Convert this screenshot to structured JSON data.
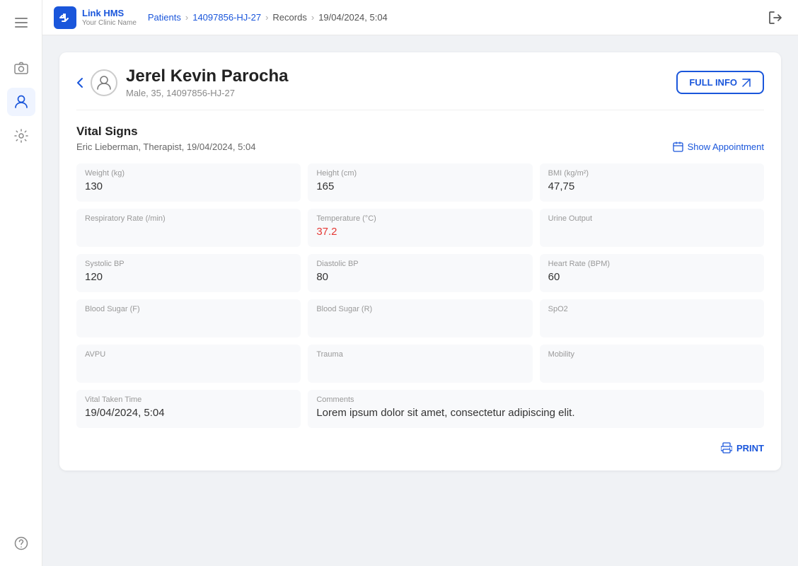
{
  "app": {
    "title": "Link HMS",
    "subtitle": "Your Clinic Name"
  },
  "topnav": {
    "menu_icon": "☰",
    "breadcrumb": {
      "patients": "Patients",
      "patient_id": "14097856-HJ-27",
      "records": "Records",
      "timestamp": "19/04/2024, 5:04"
    },
    "logout_icon": "⇥"
  },
  "sidebar": {
    "items": [
      {
        "name": "calendar-icon",
        "icon": "📷",
        "active": false
      },
      {
        "name": "patients-icon",
        "icon": "👤",
        "active": true
      },
      {
        "name": "settings-icon",
        "icon": "⚙",
        "active": false
      },
      {
        "name": "help-icon",
        "icon": "?",
        "active": false
      }
    ]
  },
  "patient": {
    "name": "Jerel Kevin Parocha",
    "meta": "Male, 35, 14097856-HJ-27",
    "full_info_label": "FULL INFO"
  },
  "vital_signs": {
    "section_title": "Vital Signs",
    "provider": "Eric Lieberman, Therapist, 19/04/2024, 5:04",
    "show_appointment_label": "Show Appointment",
    "fields": [
      {
        "label": "Weight (kg)",
        "value": "130",
        "highlight": false,
        "span": 1
      },
      {
        "label": "Height (cm)",
        "value": "165",
        "highlight": false,
        "span": 1
      },
      {
        "label": "BMI (kg/m²)",
        "value": "47,75",
        "highlight": false,
        "span": 1
      },
      {
        "label": "Respiratory Rate (/min)",
        "value": "",
        "highlight": false,
        "span": 1
      },
      {
        "label": "Temperature (°C)",
        "value": "37.2",
        "highlight": true,
        "span": 1
      },
      {
        "label": "Urine Output",
        "value": "",
        "highlight": false,
        "span": 1
      },
      {
        "label": "Systolic BP",
        "value": "120",
        "highlight": false,
        "span": 1
      },
      {
        "label": "Diastolic BP",
        "value": "80",
        "highlight": false,
        "span": 1
      },
      {
        "label": "Heart Rate (BPM)",
        "value": "60",
        "highlight": false,
        "span": 1
      },
      {
        "label": "Blood Sugar (F)",
        "value": "",
        "highlight": false,
        "span": 1
      },
      {
        "label": "Blood Sugar (R)",
        "value": "",
        "highlight": false,
        "span": 1
      },
      {
        "label": "SpO2",
        "value": "",
        "highlight": false,
        "span": 1
      },
      {
        "label": "AVPU",
        "value": "",
        "highlight": false,
        "span": 1
      },
      {
        "label": "Trauma",
        "value": "",
        "highlight": false,
        "span": 1
      },
      {
        "label": "Mobility",
        "value": "",
        "highlight": false,
        "span": 1
      },
      {
        "label": "Vital Taken Time",
        "value": "19/04/2024, 5:04",
        "highlight": false,
        "span": 1
      },
      {
        "label": "Comments",
        "value": "Lorem ipsum dolor sit amet, consectetur adipiscing elit.",
        "highlight": false,
        "span": 2
      }
    ],
    "print_label": "PRINT"
  }
}
